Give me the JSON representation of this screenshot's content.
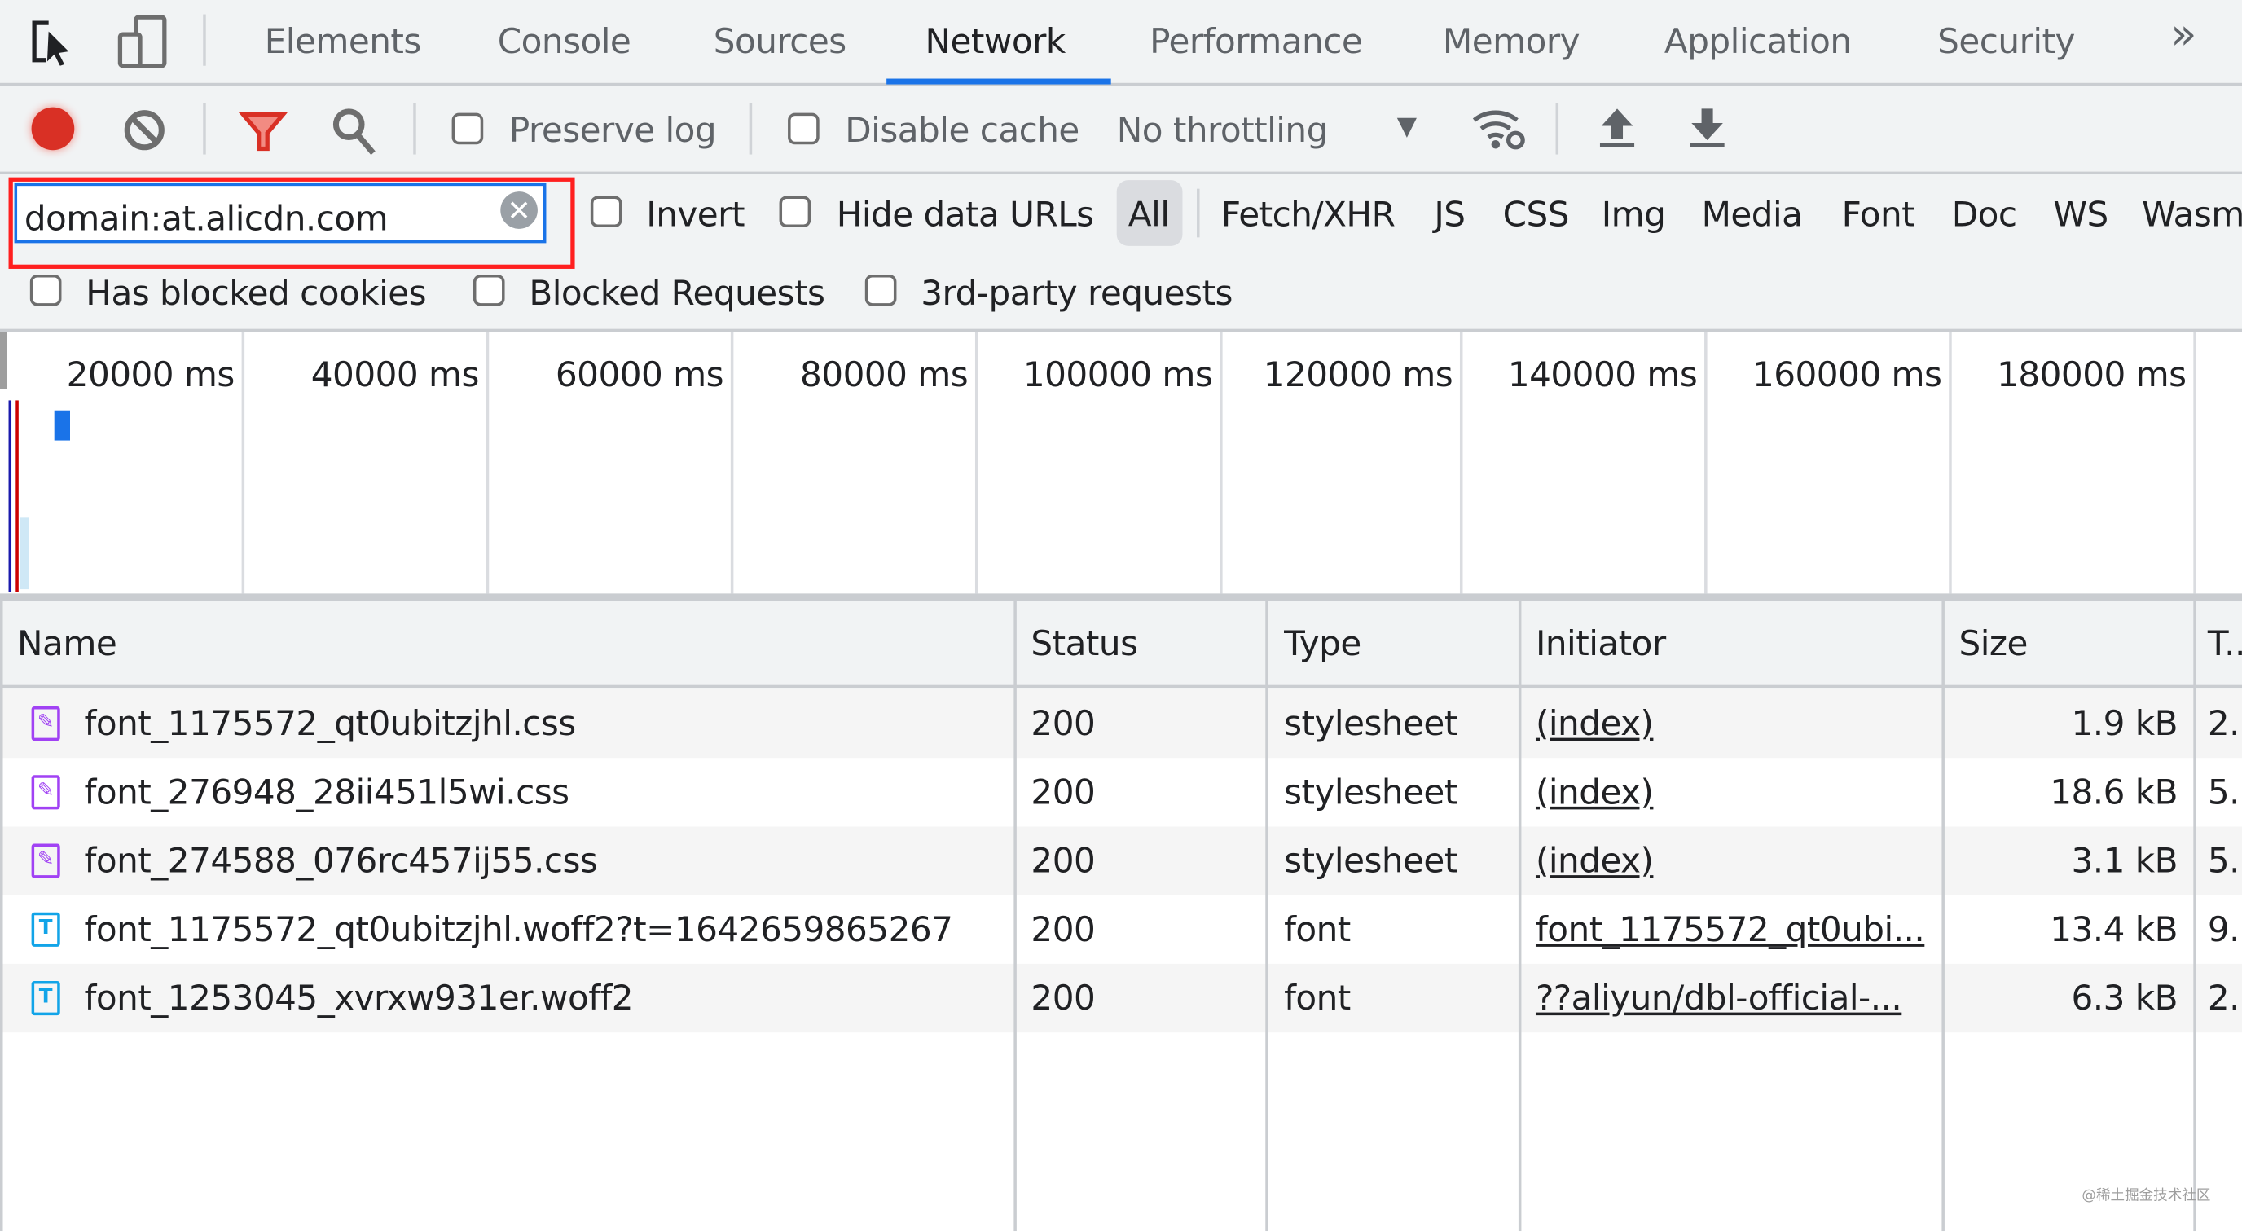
{
  "tabs": {
    "items": [
      "Elements",
      "Console",
      "Sources",
      "Network",
      "Performance",
      "Memory",
      "Application",
      "Security"
    ],
    "active": "Network",
    "more": "»"
  },
  "toolbar": {
    "preserve_log": "Preserve log",
    "disable_cache": "Disable cache",
    "throttling": "No throttling",
    "throttling_arrow": "▼"
  },
  "filter": {
    "value": "domain:at.alicdn.com",
    "invert": "Invert",
    "hide_data_urls": "Hide data URLs",
    "types": [
      "All",
      "Fetch/XHR",
      "JS",
      "CSS",
      "Img",
      "Media",
      "Font",
      "Doc",
      "WS",
      "Wasm"
    ],
    "active_type": "All",
    "has_blocked_cookies": "Has blocked cookies",
    "blocked_requests": "Blocked Requests",
    "third_party": "3rd-party requests"
  },
  "overview": {
    "ticks": [
      "20000 ms",
      "40000 ms",
      "60000 ms",
      "80000 ms",
      "100000 ms",
      "120000 ms",
      "140000 ms",
      "160000 ms",
      "180000 ms"
    ]
  },
  "table": {
    "columns": [
      "Name",
      "Status",
      "Type",
      "Initiator",
      "Size",
      "T..."
    ],
    "rows": [
      {
        "icon": "stylesheet-icon",
        "name": "font_1175572_qt0ubitzjhl.css",
        "status": "200",
        "type": "stylesheet",
        "initiator": "(index)",
        "size": "1.9 kB",
        "time": "2..."
      },
      {
        "icon": "stylesheet-icon",
        "name": "font_276948_28ii451l5wi.css",
        "status": "200",
        "type": "stylesheet",
        "initiator": "(index)",
        "size": "18.6 kB",
        "time": "5..."
      },
      {
        "icon": "stylesheet-icon",
        "name": "font_274588_076rc457ij55.css",
        "status": "200",
        "type": "stylesheet",
        "initiator": "(index)",
        "size": "3.1 kB",
        "time": "5..."
      },
      {
        "icon": "font-icon",
        "name": "font_1175572_qt0ubitzjhl.woff2?t=1642659865267",
        "status": "200",
        "type": "font",
        "initiator": "font_1175572_qt0ubi...",
        "size": "13.4 kB",
        "time": "9..."
      },
      {
        "icon": "font-icon",
        "name": "font_1253045_xvrxw931er.woff2",
        "status": "200",
        "type": "font",
        "initiator": "??aliyun/dbl-official-...",
        "size": "6.3 kB",
        "time": "2..."
      }
    ]
  },
  "watermark": "@稀土掘金技术社区",
  "colors": {
    "accent": "#1a73e8",
    "record": "#d93025",
    "highlight": "#ff1f1f",
    "stylesheet": "#a142f4",
    "font": "#12a4e8"
  }
}
